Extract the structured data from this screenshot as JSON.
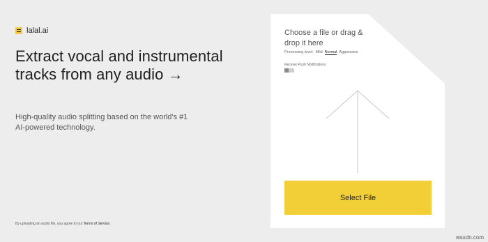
{
  "brand": {
    "name": "lalal.ai"
  },
  "hero": {
    "headline": "Extract vocal and instrumental tracks from any audio →",
    "subtitle": "High-quality audio splitting based on the world's #1 AI-powered technology."
  },
  "footer": {
    "terms_prefix": "By uploading an audio file, you agree to our",
    "terms_link": "Terms of Service."
  },
  "upload_card": {
    "prompt": "Choose a file or drag & drop it here",
    "processing_label": "Processing level:",
    "processing_options": [
      "Mild",
      "Normal",
      "Aggressive"
    ],
    "processing_selected": "Normal",
    "push_label": "Receive Push Notifications",
    "push_enabled": false,
    "select_button": "Select File",
    "icon": "upload-arrow-icon"
  },
  "watermark": "wsxdn.com",
  "colors": {
    "background": "#ededed",
    "card": "#ffffff",
    "accent": "#f2cf37",
    "text": "#1e1e1e"
  }
}
